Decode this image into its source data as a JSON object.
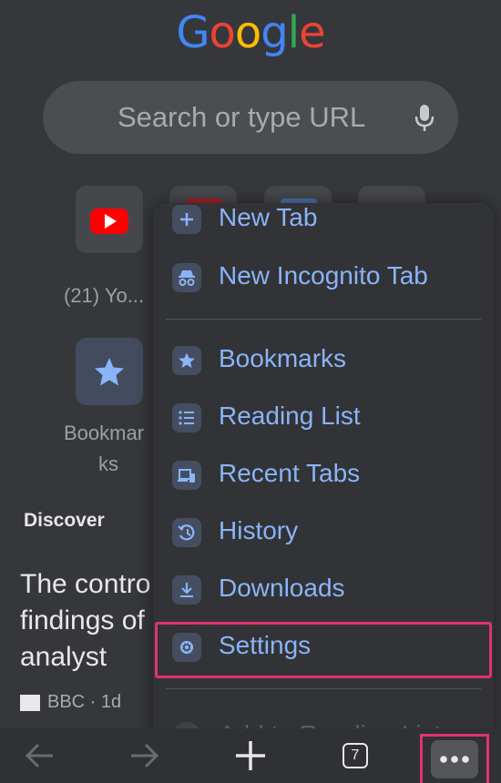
{
  "logo": {
    "letters": [
      "G",
      "o",
      "o",
      "g",
      "l",
      "e"
    ],
    "colors": [
      "#4285f4",
      "#ea4335",
      "#fbbc05",
      "#4285f4",
      "#34a853",
      "#ea4335"
    ]
  },
  "search": {
    "placeholder": "Search or type URL"
  },
  "shortcuts": [
    {
      "label": "(21) Yo...",
      "icon": "youtube-icon"
    }
  ],
  "bookmarks_tile": {
    "label_line1": "Bookmar",
    "label_line2": "ks",
    "icon": "star-icon"
  },
  "discover": {
    "heading": "Discover"
  },
  "article": {
    "line1": "The contro",
    "line2": "findings of",
    "line3": "analyst",
    "source": "BBC · 1d"
  },
  "menu": {
    "items": [
      {
        "label": "New Tab",
        "icon": "plus-icon"
      },
      {
        "label": "New Incognito Tab",
        "icon": "incognito-icon"
      },
      {
        "label": "Bookmarks",
        "icon": "star-icon"
      },
      {
        "label": "Reading List",
        "icon": "list-icon"
      },
      {
        "label": "Recent Tabs",
        "icon": "devices-icon"
      },
      {
        "label": "History",
        "icon": "history-icon"
      },
      {
        "label": "Downloads",
        "icon": "download-icon"
      },
      {
        "label": "Settings",
        "icon": "gear-icon"
      },
      {
        "label": "Add to Reading List",
        "icon": "add-circle-icon"
      }
    ]
  },
  "toolbar": {
    "tab_count": "7"
  },
  "colors": {
    "accent": "#8ab4f8",
    "highlight": "#e0336b",
    "background": "#36373b"
  }
}
